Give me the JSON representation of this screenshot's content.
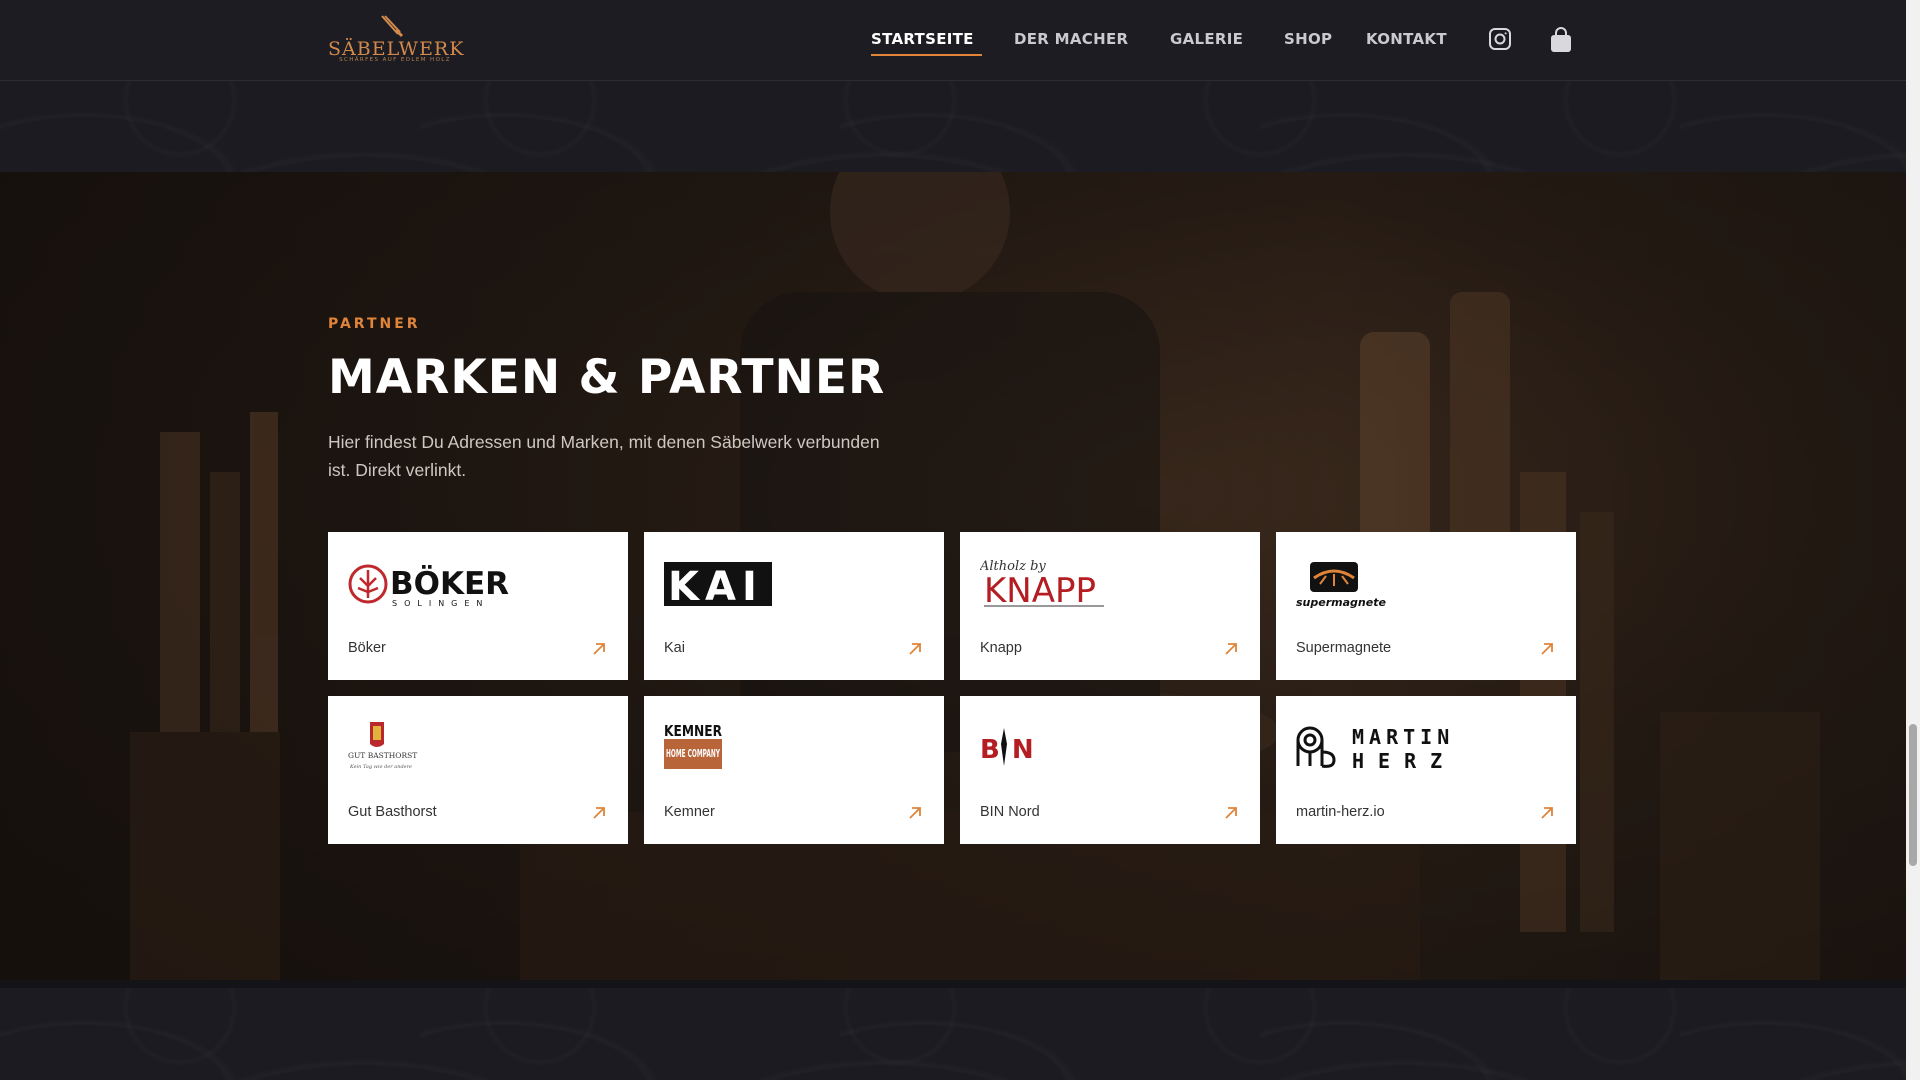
{
  "site": {
    "logo_title": "SÄBELWERK",
    "logo_tagline": "SCHÄRFES AUF EDLEM HOLZ",
    "accent_color": "#e0843a"
  },
  "nav": {
    "items": [
      {
        "label": "STARTSEITE",
        "active": true
      },
      {
        "label": "DER MACHER",
        "active": false
      },
      {
        "label": "GALERIE",
        "active": false
      },
      {
        "label": "SHOP",
        "active": false
      },
      {
        "label": "KONTAKT",
        "active": false
      }
    ],
    "icons": [
      "instagram-icon",
      "shopping-bag-icon"
    ]
  },
  "partners_section": {
    "eyebrow": "PARTNER",
    "title": "MARKEN & PARTNER",
    "description": "Hier findest Du Adressen und Marken, mit denen Säbelwerk verbunden ist. Direkt verlinkt."
  },
  "partners": [
    {
      "name": "Böker",
      "logo": "böker-logo",
      "logo_text": "BÖKER",
      "logo_sub": "SOLINGEN"
    },
    {
      "name": "Kai",
      "logo": "kai-logo",
      "logo_text": "KAI"
    },
    {
      "name": "Knapp",
      "logo": "knapp-logo",
      "logo_text": "KNAPP",
      "logo_sub": "Altholz by"
    },
    {
      "name": "Supermagnete",
      "logo": "supermagnete-logo",
      "logo_text": "supermagnete"
    },
    {
      "name": "Gut Basthorst",
      "logo": "gut-basthorst-logo",
      "logo_text": "GUT BASTHORST",
      "logo_sub": "Kein Tag wie der andere"
    },
    {
      "name": "Kemner",
      "logo": "kemner-logo",
      "logo_text": "KEMNER",
      "logo_sub": "HOME COMPANY"
    },
    {
      "name": "BIN Nord",
      "logo": "bin-nord-logo",
      "logo_text": "BN"
    },
    {
      "name": "martin-herz.io",
      "logo": "martin-herz-logo",
      "logo_text": "MARTIN",
      "logo_sub": "HERZ"
    }
  ]
}
